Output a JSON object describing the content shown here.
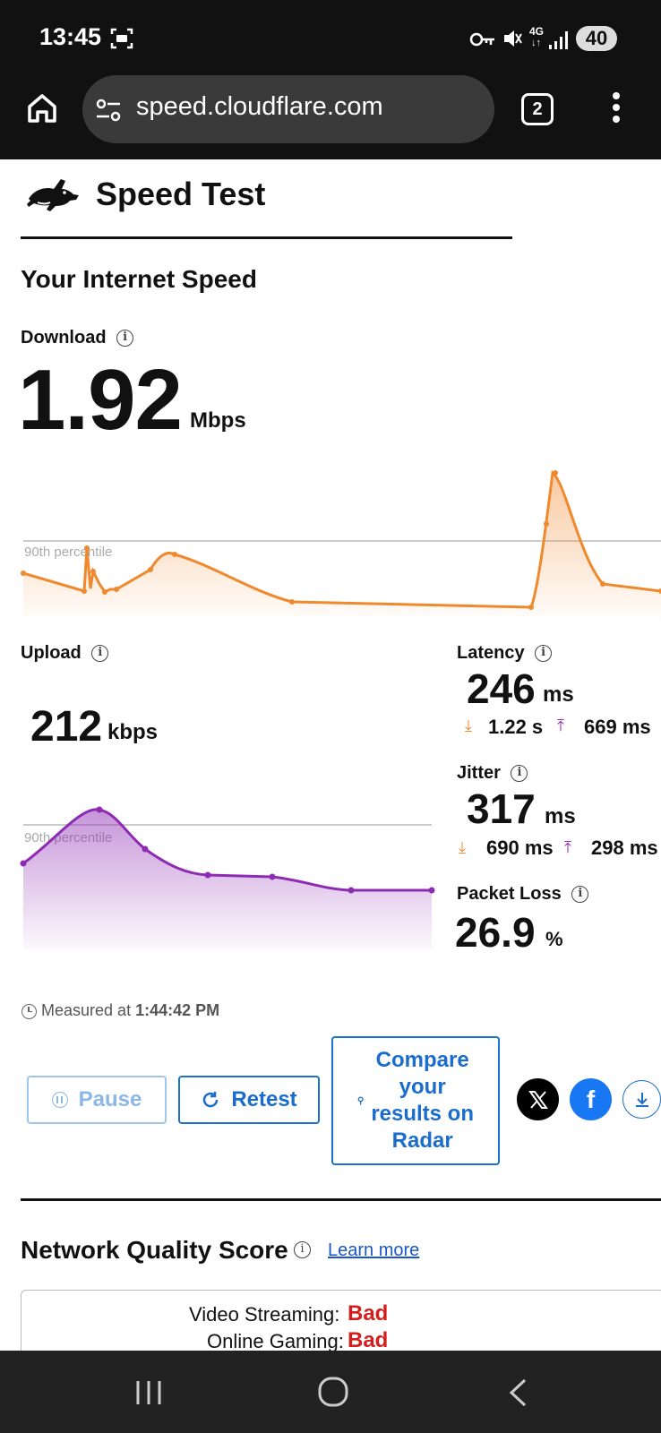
{
  "status_bar": {
    "time": "13:45",
    "network": "4G",
    "battery": "40"
  },
  "browser": {
    "url": "speed.cloudflare.com",
    "tab_count": "2"
  },
  "header": {
    "title": "Speed Test"
  },
  "section_title": "Your Internet Speed",
  "download": {
    "label": "Download",
    "value": "1.92",
    "unit": "Mbps",
    "percentile_label": "90th percentile"
  },
  "upload": {
    "label": "Upload",
    "value": "212",
    "unit": "kbps",
    "percentile_label": "90th percentile"
  },
  "latency": {
    "label": "Latency",
    "value": "246",
    "unit": "ms",
    "down": "1.22 s",
    "up": "669 ms"
  },
  "jitter": {
    "label": "Jitter",
    "value": "317",
    "unit": "ms",
    "down": "690 ms",
    "up": "298 ms"
  },
  "packet_loss": {
    "label": "Packet Loss",
    "value": "26.9",
    "unit": "%"
  },
  "measured": {
    "prefix": "Measured at",
    "time": "1:44:42 PM"
  },
  "buttons": {
    "pause": "Pause",
    "retest": "Retest",
    "compare": [
      "Compare",
      "your",
      "results on",
      "Radar"
    ]
  },
  "network_quality": {
    "title": "Network Quality Score",
    "learn_more": "Learn more",
    "rows": [
      {
        "label": "Video Streaming:",
        "value": "Bad"
      },
      {
        "label": "Online Gaming:",
        "value": "Bad"
      }
    ]
  },
  "colors": {
    "download": "#f0892e",
    "upload": "#8e2bb3",
    "accent": "#1a6dcc",
    "bad": "#d41e1e"
  }
}
